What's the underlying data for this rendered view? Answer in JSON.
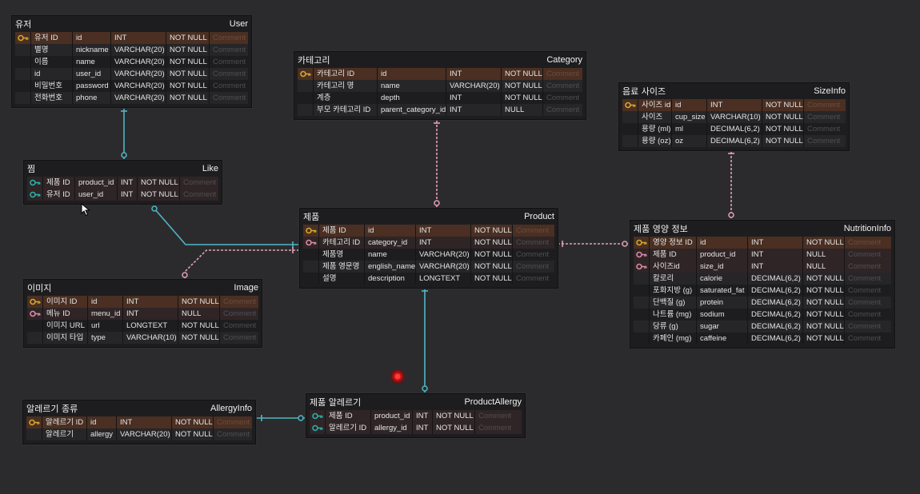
{
  "comment_placeholder": "Comment",
  "colors": {
    "background": "#2b2b2d",
    "table_bg": "#1d1d1f",
    "pk_row": "#4a2f22",
    "key_gold": "#d4a72c",
    "key_teal": "#2ab0a7",
    "key_pink": "#d98aa6",
    "rel_solid": "#4fb7c4",
    "rel_dashed": "#e3a0b4"
  },
  "tables": [
    {
      "id": "User",
      "kr": "유저",
      "en": "User",
      "key": "user",
      "rows": [
        {
          "key": "gold",
          "kr": "유저 ID",
          "name": "id",
          "type": "INT",
          "null": "NOT NULL"
        },
        {
          "key": "",
          "kr": "별명",
          "name": "nickname",
          "type": "VARCHAR(20)",
          "null": "NOT NULL"
        },
        {
          "key": "",
          "kr": "이름",
          "name": "name",
          "type": "VARCHAR(20)",
          "null": "NOT NULL"
        },
        {
          "key": "",
          "kr": "id",
          "name": "user_id",
          "type": "VARCHAR(20)",
          "null": "NOT NULL"
        },
        {
          "key": "",
          "kr": "비밀번호",
          "name": "password",
          "type": "VARCHAR(20)",
          "null": "NOT NULL"
        },
        {
          "key": "",
          "kr": "전화번호",
          "name": "phone",
          "type": "VARCHAR(20)",
          "null": "NOT NULL"
        }
      ]
    },
    {
      "id": "Category",
      "kr": "카테고리",
      "en": "Category",
      "key": "category",
      "rows": [
        {
          "key": "gold",
          "kr": "카테고리 ID",
          "name": "id",
          "type": "INT",
          "null": "NOT NULL"
        },
        {
          "key": "",
          "kr": "카테고리 명",
          "name": "name",
          "type": "VARCHAR(20)",
          "null": "NOT NULL"
        },
        {
          "key": "",
          "kr": "계층",
          "name": "depth",
          "type": "INT",
          "null": "NOT NULL"
        },
        {
          "key": "",
          "kr": "부모 카테고리 ID",
          "name": "parent_category_id",
          "type": "INT",
          "null": "NULL"
        }
      ]
    },
    {
      "id": "SizeInfo",
      "kr": "음료 사이즈",
      "en": "SizeInfo",
      "key": "sizeinfo",
      "rows": [
        {
          "key": "gold",
          "kr": "사이즈 id",
          "name": "id",
          "type": "INT",
          "null": "NOT NULL"
        },
        {
          "key": "",
          "kr": "사이즈",
          "name": "cup_size",
          "type": "VARCHAR(10)",
          "null": "NOT NULL"
        },
        {
          "key": "",
          "kr": "용량 (ml)",
          "name": "ml",
          "type": "DECIMAL(6,2)",
          "null": "NOT NULL"
        },
        {
          "key": "",
          "kr": "용량 (oz)",
          "name": "oz",
          "type": "DECIMAL(6,2)",
          "null": "NOT NULL"
        }
      ]
    },
    {
      "id": "Like",
      "kr": "찜",
      "en": "Like",
      "key": "like",
      "rows": [
        {
          "key": "teal",
          "kr": "제품 ID",
          "name": "product_id",
          "type": "INT",
          "null": "NOT NULL"
        },
        {
          "key": "teal",
          "kr": "유저 ID",
          "name": "user_id",
          "type": "INT",
          "null": "NOT NULL"
        }
      ]
    },
    {
      "id": "Product",
      "kr": "제품",
      "en": "Product",
      "key": "product",
      "rows": [
        {
          "key": "gold",
          "kr": "제품 ID",
          "name": "id",
          "type": "INT",
          "null": "NOT NULL"
        },
        {
          "key": "pink",
          "kr": "카테고리 ID",
          "name": "category_id",
          "type": "INT",
          "null": "NOT NULL"
        },
        {
          "key": "",
          "kr": "제품명",
          "name": "name",
          "type": "VARCHAR(20)",
          "null": "NOT NULL"
        },
        {
          "key": "",
          "kr": "제품 영문명",
          "name": "english_name",
          "type": "VARCHAR(20)",
          "null": "NOT NULL"
        },
        {
          "key": "",
          "kr": "설명",
          "name": "description",
          "type": "LONGTEXT",
          "null": "NOT NULL"
        }
      ]
    },
    {
      "id": "NutritionInfo",
      "kr": "제품 영양 정보",
      "en": "NutritionInfo",
      "key": "nutrition",
      "rows": [
        {
          "key": "gold",
          "kr": "영양 정보 ID",
          "name": "id",
          "type": "INT",
          "null": "NOT NULL"
        },
        {
          "key": "pink",
          "kr": "제품 ID",
          "name": "product_id",
          "type": "INT",
          "null": "NULL"
        },
        {
          "key": "pink",
          "kr": "사이즈id",
          "name": "size_id",
          "type": "INT",
          "null": "NULL"
        },
        {
          "key": "",
          "kr": "칼로리",
          "name": "calorie",
          "type": "DECIMAL(6,2)",
          "null": "NOT NULL"
        },
        {
          "key": "",
          "kr": "포화지방 (g)",
          "name": "saturated_fat",
          "type": "DECIMAL(6,2)",
          "null": "NOT NULL"
        },
        {
          "key": "",
          "kr": "단백질 (g)",
          "name": "protein",
          "type": "DECIMAL(6,2)",
          "null": "NOT NULL"
        },
        {
          "key": "",
          "kr": "나트륨 (mg)",
          "name": "sodium",
          "type": "DECIMAL(6,2)",
          "null": "NOT NULL"
        },
        {
          "key": "",
          "kr": "당류 (g)",
          "name": "sugar",
          "type": "DECIMAL(6,2)",
          "null": "NOT NULL"
        },
        {
          "key": "",
          "kr": "카페인 (mg)",
          "name": "caffeine",
          "type": "DECIMAL(6,2)",
          "null": "NOT NULL"
        }
      ]
    },
    {
      "id": "Image",
      "kr": "이미지",
      "en": "Image",
      "key": "image",
      "rows": [
        {
          "key": "gold",
          "kr": "이미지 ID",
          "name": "id",
          "type": "INT",
          "null": "NOT NULL"
        },
        {
          "key": "pink",
          "kr": "메뉴 ID",
          "name": "menu_id",
          "type": "INT",
          "null": "NULL"
        },
        {
          "key": "",
          "kr": "이미지 URL",
          "name": "url",
          "type": "LONGTEXT",
          "null": "NOT NULL"
        },
        {
          "key": "",
          "kr": "이미지 타입",
          "name": "type",
          "type": "VARCHAR(10)",
          "null": "NOT NULL"
        }
      ]
    },
    {
      "id": "AllergyInfo",
      "kr": "알레르기 종류",
      "en": "AllergyInfo",
      "key": "allergyinfo",
      "rows": [
        {
          "key": "gold",
          "kr": "알레르기 ID",
          "name": "id",
          "type": "INT",
          "null": "NOT NULL"
        },
        {
          "key": "",
          "kr": "알레르기",
          "name": "allergy",
          "type": "VARCHAR(20)",
          "null": "NOT NULL"
        }
      ]
    },
    {
      "id": "ProductAllergy",
      "kr": "제품 알레르기",
      "en": "ProductAllergy",
      "key": "productallergy",
      "rows": [
        {
          "key": "teal",
          "kr": "제품 ID",
          "name": "product_id",
          "type": "INT",
          "null": "NOT NULL"
        },
        {
          "key": "teal",
          "kr": "알레르기 ID",
          "name": "allergy_id",
          "type": "INT",
          "null": "NOT NULL"
        }
      ]
    }
  ],
  "relationships": [
    {
      "from": "User",
      "to": "Like",
      "style": "solid"
    },
    {
      "from": "Product",
      "to": "Like",
      "style": "solid"
    },
    {
      "from": "Category",
      "to": "Product",
      "style": "dashed"
    },
    {
      "from": "Product",
      "to": "Image",
      "style": "dashed"
    },
    {
      "from": "Product",
      "to": "NutritionInfo",
      "style": "dashed"
    },
    {
      "from": "SizeInfo",
      "to": "NutritionInfo",
      "style": "dashed"
    },
    {
      "from": "Product",
      "to": "ProductAllergy",
      "style": "solid"
    },
    {
      "from": "AllergyInfo",
      "to": "ProductAllergy",
      "style": "solid"
    }
  ]
}
